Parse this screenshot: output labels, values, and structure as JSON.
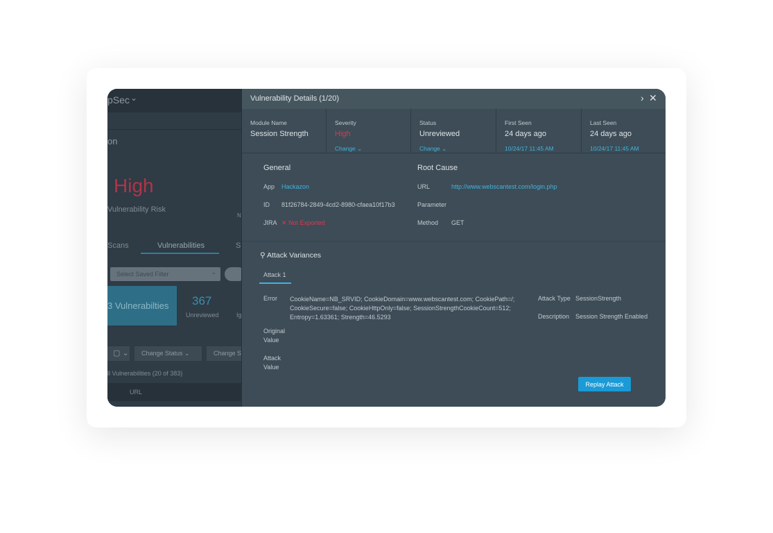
{
  "background_app": {
    "app_name": "pSec",
    "page_title": "on",
    "risk_level": "High",
    "risk_label": "Vulnerability Risk",
    "side_letter": "N",
    "tabs": [
      "Scans",
      "Vulnerabilities",
      "S"
    ],
    "saved_filter_placeholder": "Select Saved Filter",
    "total_tile": "3 Vulnerabilties",
    "unreviewed_count": "367",
    "unreviewed_label": "Unreviewed",
    "ignored_label": "Ig",
    "change_status": "Change Status",
    "change_severity": "Change S",
    "list_caption": "ll Vulnerabilities (20 of 383)",
    "column_url": "URL"
  },
  "details": {
    "title": "Vulnerability Details (1/20)",
    "meta": [
      {
        "label": "Module Name",
        "value": "Session Strength"
      },
      {
        "label": "Severity",
        "value": "High",
        "action": "Change"
      },
      {
        "label": "Status",
        "value": "Unreviewed",
        "action": "Change"
      },
      {
        "label": "First Seen",
        "value": "24 days ago",
        "date": "10/24/17 11:45 AM"
      },
      {
        "label": "Last Seen",
        "value": "24 days ago",
        "date": "10/24/17 11:45 AM"
      }
    ],
    "general": {
      "title": "General",
      "app_label": "App",
      "app": "Hackazon",
      "id_label": "ID",
      "id": "81f26784-2849-4cd2-8980-cfaea10f17b3",
      "jira_label": "JIRA",
      "jira": "Not Exported"
    },
    "root_cause": {
      "title": "Root Cause",
      "url_label": "URL",
      "url": "http://www.webscantest.com/login.php",
      "param_label": "Parameter",
      "method_label": "Method",
      "method": "GET"
    },
    "attack": {
      "title": "Attack Variances",
      "tab": "Attack 1",
      "error_label": "Error",
      "error_lines": [
        "CookieName=NB_SRVID; CookieDomain=www.webscantest.com; CookiePath=/;",
        "CookieSecure=false; CookieHttpOnly=false; SessionStrengthCookieCount=512;",
        "Entropy=1.63361; Strength=46.5293"
      ],
      "original_label_1": "Original",
      "original_label_2": "Value",
      "attack_label_1": "Attack",
      "attack_label_2": "Value",
      "type_label": "Attack Type",
      "type": "SessionStrength",
      "desc_label": "Description",
      "desc": "Session Strength Enabled",
      "replay": "Replay Attack"
    }
  },
  "colors": {
    "accent": "#3fb4de",
    "danger": "#e0364f",
    "button": "#1a9ad6"
  }
}
